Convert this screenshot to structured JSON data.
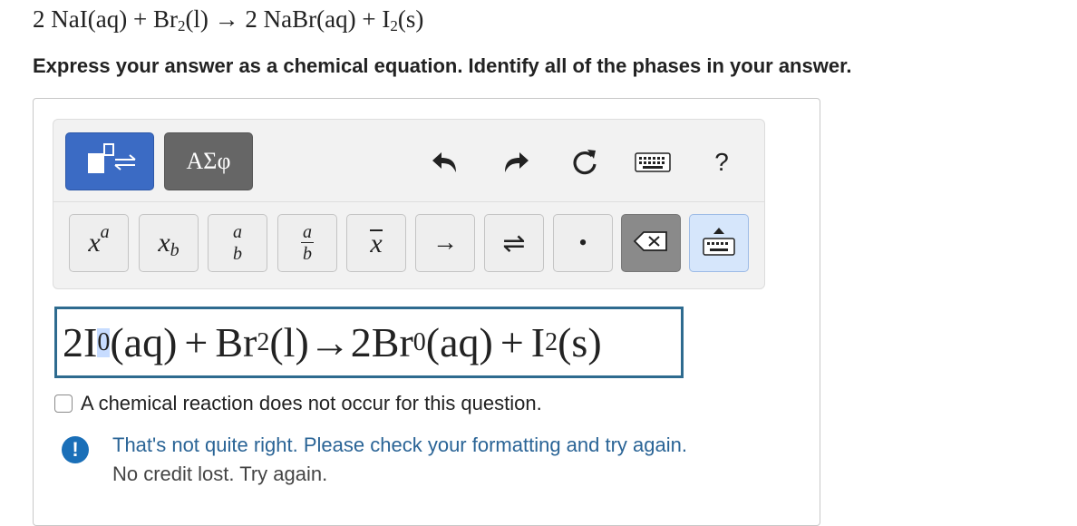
{
  "question": {
    "coef1": "2",
    "r1": "NaI(aq)",
    "plus1": "+",
    "r2": "Br",
    "r2_sub": "2",
    "r2_phase": "(l)",
    "arrow": "→",
    "coef2": "2",
    "p1": "NaBr(aq)",
    "plus2": "+",
    "p2": "I",
    "p2_sub": "2",
    "p2_phase": "(s)"
  },
  "instruction": "Express your answer as a chemical equation. Identify all of the phases in your answer.",
  "toolbar": {
    "tabs": {
      "templates_icon": "template-arrows-icon",
      "greek_label": "ΑΣφ"
    },
    "tools": [
      "undo-icon",
      "redo-icon",
      "reset-icon",
      "keyboard-icon"
    ],
    "help_label": "?",
    "keys": {
      "superscript": {
        "base": "x",
        "sup": "a"
      },
      "subscript": {
        "base": "x",
        "sub": "b"
      },
      "fraction": {
        "num": "a",
        "den": "b"
      },
      "mixed_fraction": {
        "num": "a",
        "den": "b"
      },
      "overline": "x",
      "reaction_arrow": "→",
      "equilibrium_arrow": "⇌",
      "dot": "•",
      "delete_icon": "backspace-icon",
      "keyboard_toggle_icon": "keyboard-toggle-icon"
    }
  },
  "answer": {
    "coef1": "2I",
    "sup1": "0",
    "phase1": "(aq)",
    "plus1": "+",
    "r2": "Br",
    "r2_sub": "2",
    "r2_phase": "(l)",
    "arrow": "→",
    "coef2": "2Br",
    "sup2": "0",
    "phase2": "(aq)",
    "plus2": "+",
    "p2": "I",
    "p2_sub": "2",
    "p2_phase": "(s)"
  },
  "no_reaction_label": "A chemical reaction does not occur for this question.",
  "feedback": {
    "icon": "!",
    "message": "That's not quite right. Please check your formatting and try again.",
    "credit": "No credit lost. Try again.",
    "color": "#2a6496"
  }
}
